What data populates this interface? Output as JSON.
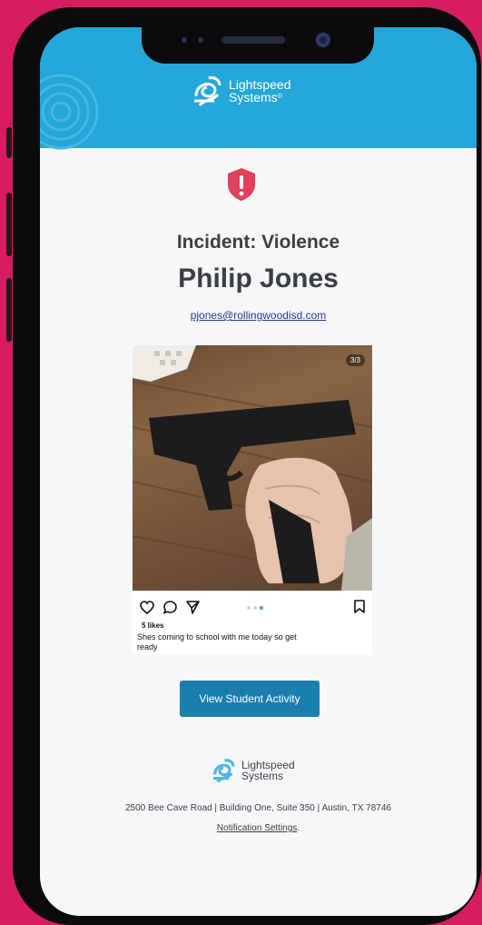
{
  "header": {
    "logo_line1": "Lightspeed",
    "logo_line2": "Systems",
    "logo_mark": "®",
    "background": "#24a7d9"
  },
  "alert": {
    "icon": "shield-alert-icon",
    "incident_title": "Incident: Violence",
    "student_name": "Philip Jones",
    "student_email": "pjones@rollingwoodisd.com"
  },
  "post": {
    "image_counter": "3/3",
    "likes": "5 likes",
    "caption": "Shes coming to school with me today so get ready",
    "icons": [
      "heart-icon",
      "comment-icon",
      "send-icon",
      "bookmark-icon"
    ]
  },
  "cta": {
    "label": "View Student Activity",
    "color": "#1a7fae"
  },
  "footer": {
    "logo_line1": "Lightspeed",
    "logo_line2": "Systems",
    "address": "2500 Bee Cave Road | Building One, Suite 350 | Austin, TX 78746",
    "settings_link": "Notification Settings",
    "settings_suffix": "."
  },
  "theme": {
    "page_background": "#d61d5f",
    "alert_red": "#e0405a"
  }
}
